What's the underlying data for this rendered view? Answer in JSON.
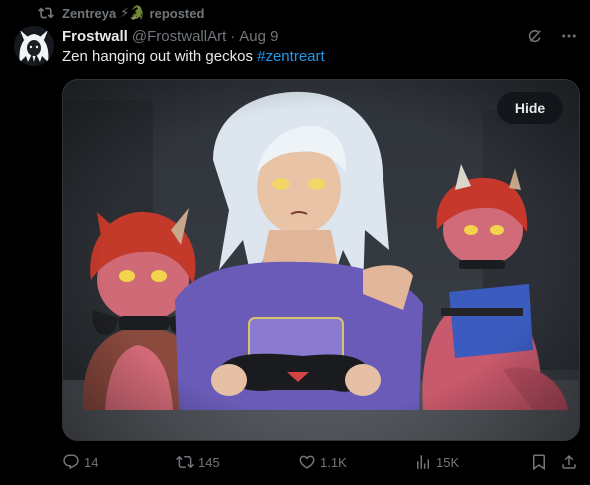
{
  "repost": {
    "user": "Zentreya",
    "emoji": "⚡🐊",
    "label": "reposted",
    "icon": "repost-icon"
  },
  "author": {
    "display_name": "Frostwall",
    "handle": "@FrostwallArt",
    "separator": "·",
    "date": "Aug 9",
    "avatar": "avatar-white-haired-character"
  },
  "post": {
    "text": "Zen hanging out with geckos ",
    "hashtag": "#zentreart"
  },
  "media": {
    "description_icon": "illustration",
    "hide_label": "Hide"
  },
  "header_icons": [
    "grok-icon",
    "more-icon"
  ],
  "actions": {
    "replies": "14",
    "reposts": "145",
    "likes": "1.1K",
    "views": "15K"
  },
  "colors": {
    "background": "#000000",
    "text": "#e7e9ea",
    "muted": "#71767b",
    "accent": "#1d9bf0"
  }
}
